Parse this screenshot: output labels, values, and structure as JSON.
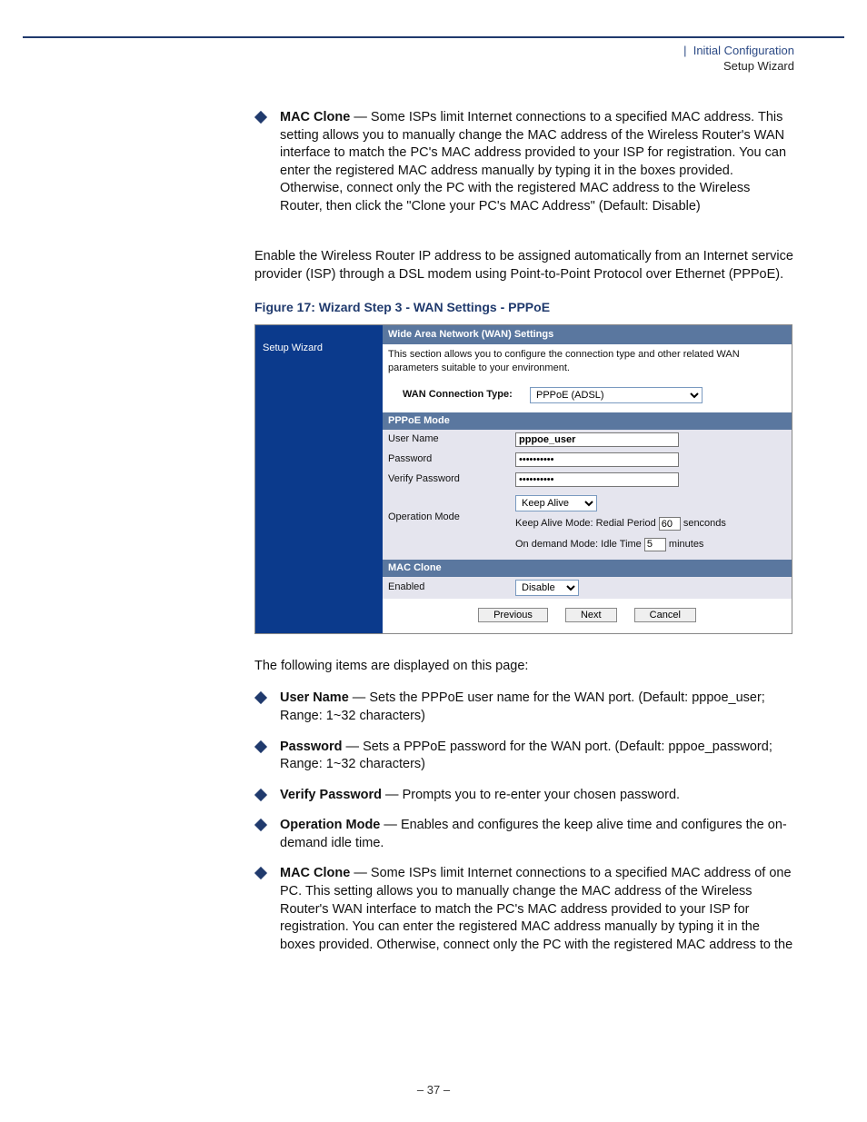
{
  "header": {
    "pipe": "|",
    "line1": "Initial Configuration",
    "line2": "Setup Wizard"
  },
  "top_bullets": [
    {
      "term": "MAC Clone",
      "sep": " — ",
      "text": "Some ISPs limit Internet connections to a specified MAC address. This setting allows you to manually change the MAC address of the Wireless Router's WAN interface to match the PC's MAC address provided to your ISP for registration. You can enter the registered MAC address manually by typing it in the boxes provided. Otherwise, connect only the PC with the registered MAC address to the Wireless Router, then click the \"Clone your PC's MAC Address\" (Default: Disable)"
    }
  ],
  "intro_para": "Enable the Wireless Router IP address to be assigned automatically from an Internet service provider (ISP) through a DSL modem using Point-to-Point Protocol over Ethernet (PPPoE).",
  "figure_caption": "Figure 17:  Wizard Step 3 - WAN Settings - PPPoE",
  "figure": {
    "sidebar": {
      "item1": "Setup Wizard"
    },
    "title_bar": "Wide Area Network (WAN) Settings",
    "desc": "This section allows you to configure the connection type and other related WAN parameters suitable to your environment.",
    "wan_type_label": "WAN Connection Type:",
    "wan_type_value": "PPPoE (ADSL)",
    "section_pppoe": "PPPoE Mode",
    "username_label": "User Name",
    "username_value": "pppoe_user",
    "password_label": "Password",
    "password_value": "••••••••••",
    "verify_label": "Verify Password",
    "verify_value": "••••••••••",
    "opmode_label": "Operation Mode",
    "opmode_select": "Keep Alive",
    "opmode_keepalive_pre": "Keep Alive Mode: Redial Period ",
    "opmode_keepalive_val": "60",
    "opmode_keepalive_post": " senconds",
    "opmode_ondemand_pre": "On demand Mode: Idle Time ",
    "opmode_ondemand_val": "5",
    "opmode_ondemand_post": " minutes",
    "section_mac": "MAC Clone",
    "mac_enabled_label": "Enabled",
    "mac_enabled_value": "Disable",
    "btn_prev": "Previous",
    "btn_next": "Next",
    "btn_cancel": "Cancel"
  },
  "after_figure": "The following items are displayed on this page:",
  "bottom_bullets": [
    {
      "term": "User Name",
      "sep": " — ",
      "text": "Sets the PPPoE user name for the WAN port. (Default: pppoe_user; Range: 1~32 characters)"
    },
    {
      "term": "Password",
      "sep": " — ",
      "text": "Sets a PPPoE password for the WAN port. (Default: pppoe_password; Range: 1~32 characters)"
    },
    {
      "term": "Verify Password",
      "sep": " — ",
      "text": "Prompts you to re-enter your chosen password."
    },
    {
      "term": "Operation Mode",
      "sep": " — ",
      "text": "Enables and configures the keep alive time and configures the on-demand idle time."
    },
    {
      "term": "MAC Clone",
      "sep": " — ",
      "text": "Some ISPs limit Internet connections to a specified MAC address of one PC. This setting allows you to manually change the MAC address of the Wireless Router's WAN interface to match the PC's MAC address provided to your ISP for registration. You can enter the registered MAC address manually by typing it in the boxes provided. Otherwise, connect only the PC with the registered MAC address to the"
    }
  ],
  "page_number": "–  37  –"
}
